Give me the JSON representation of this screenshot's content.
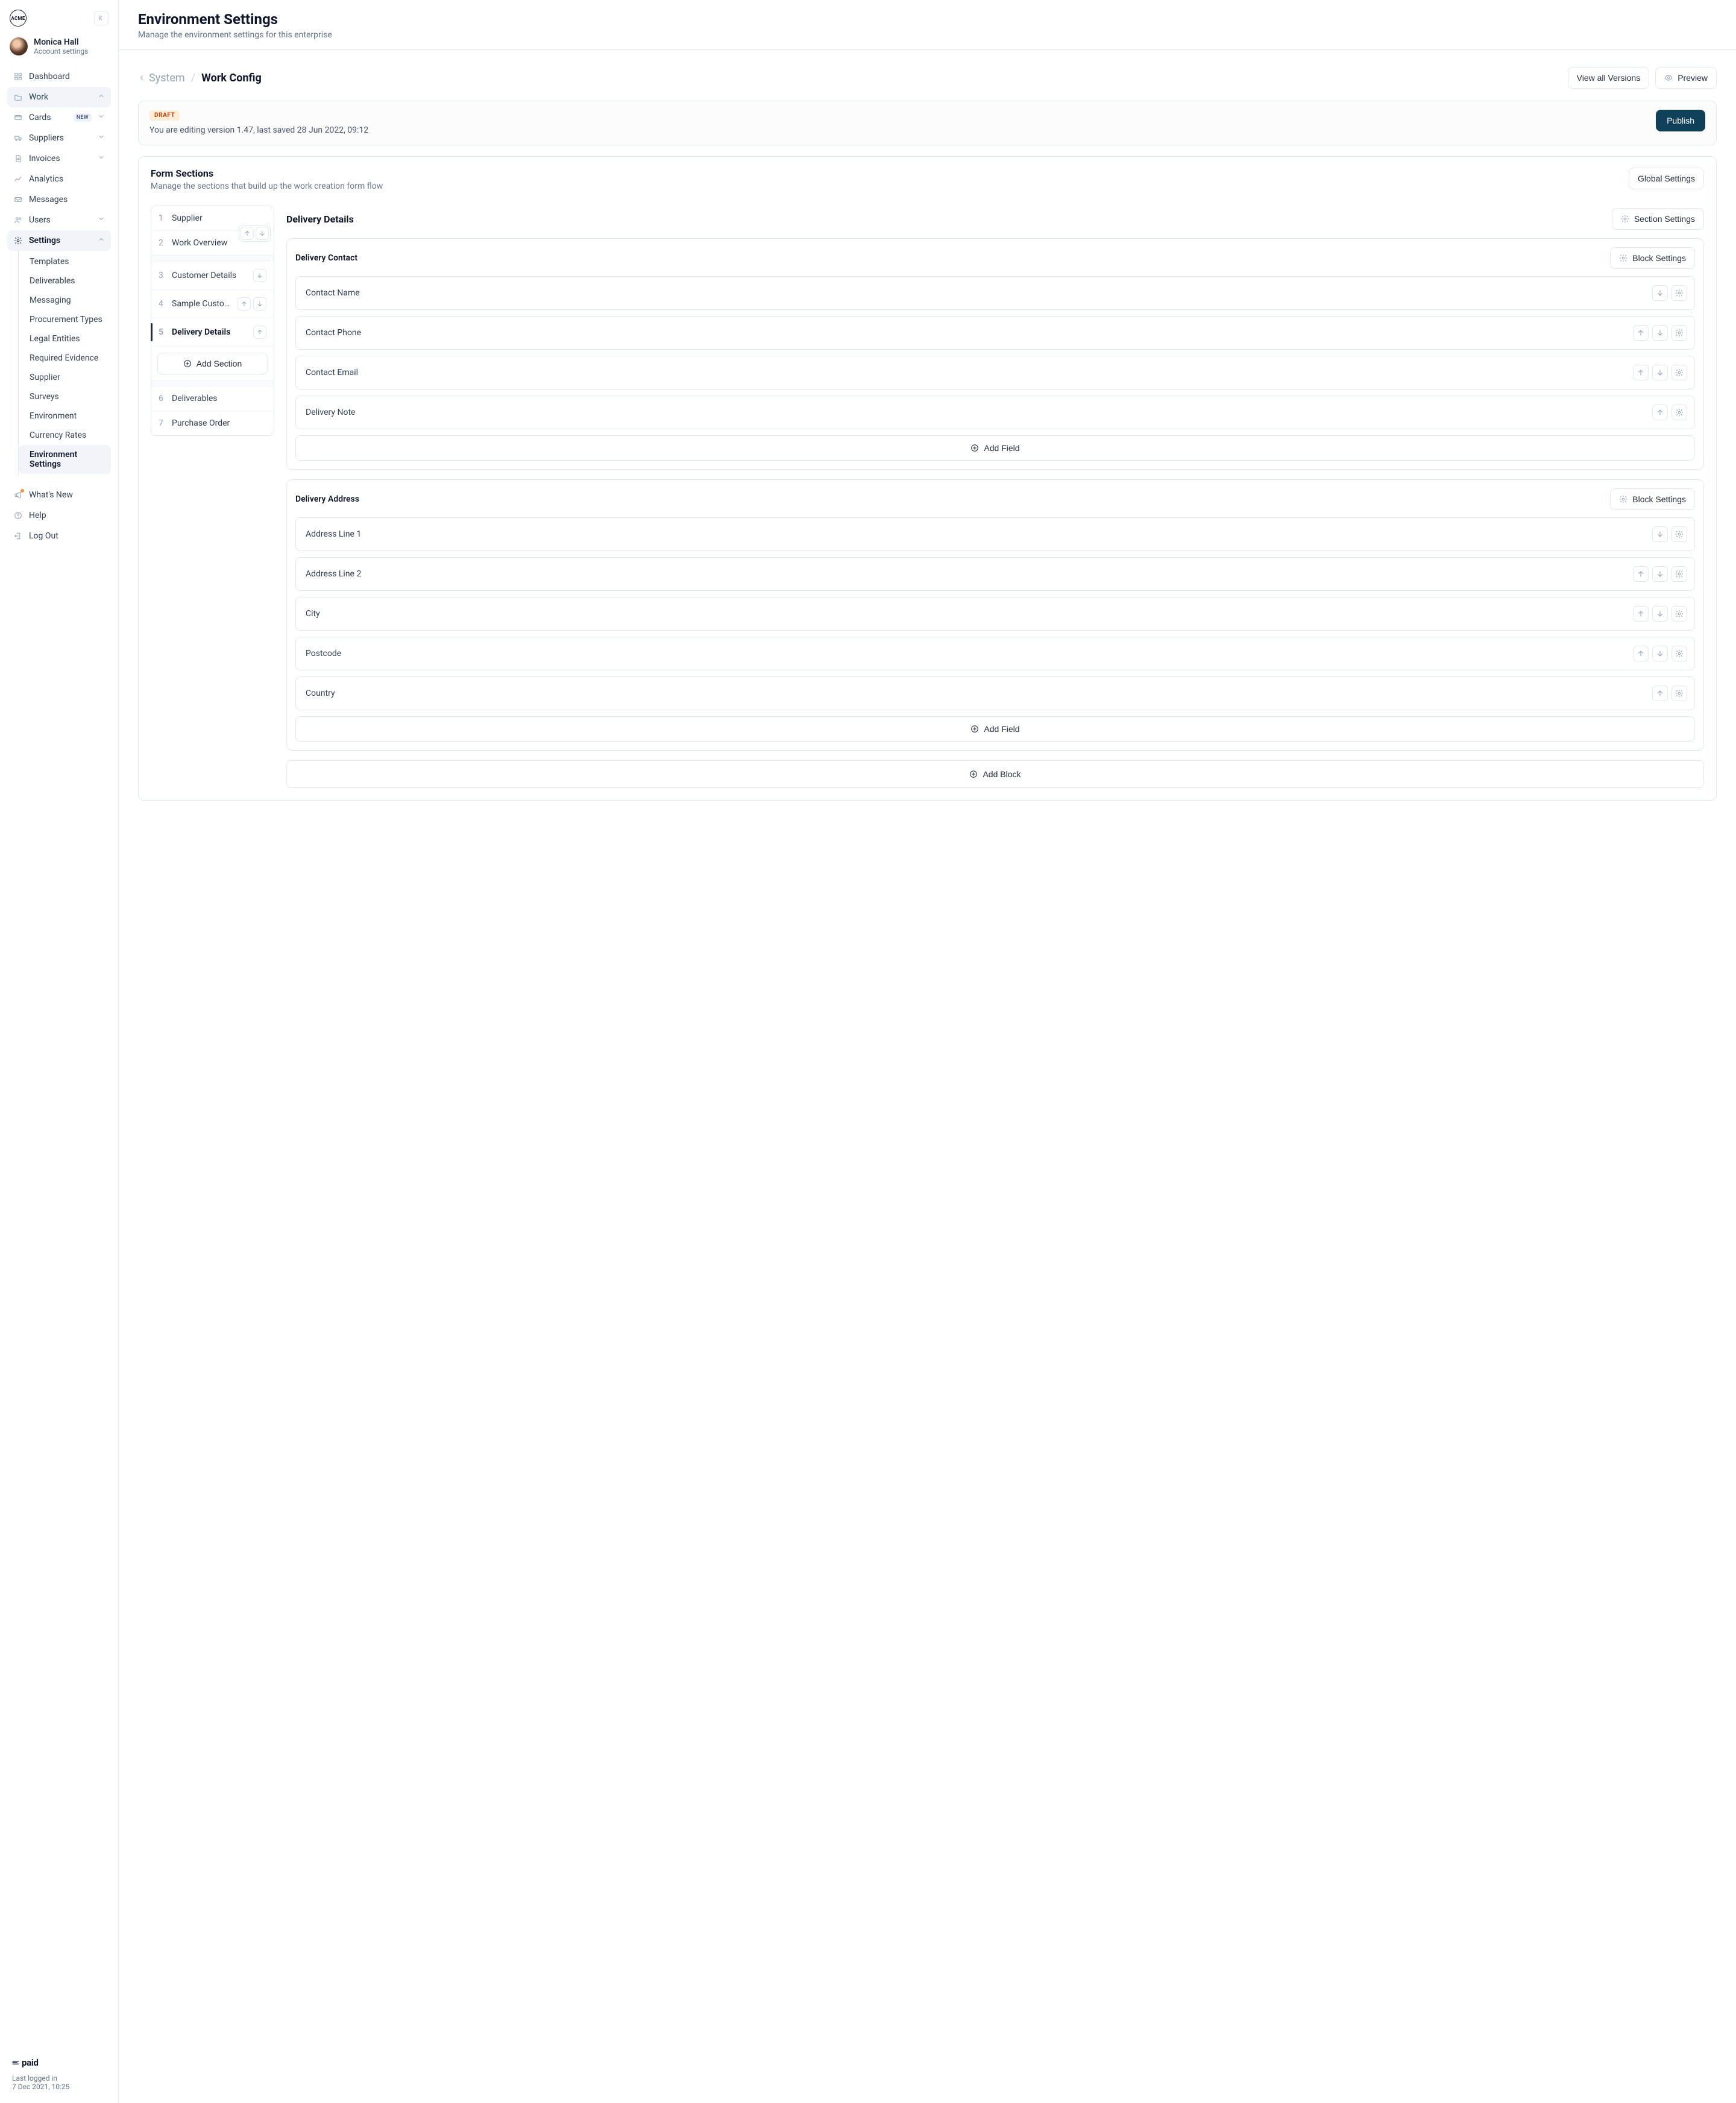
{
  "brand": "ACME",
  "user": {
    "name": "Monica Hall",
    "sub": "Account settings"
  },
  "nav": {
    "dashboard": "Dashboard",
    "work": "Work",
    "cards": "Cards",
    "cards_badge": "NEW",
    "suppliers": "Suppliers",
    "invoices": "Invoices",
    "analytics": "Analytics",
    "messages": "Messages",
    "users": "Users",
    "settings": "Settings",
    "settings_children": {
      "templates": "Templates",
      "deliverables": "Deliverables",
      "messaging": "Messaging",
      "procurement_types": "Procurement Types",
      "legal_entities": "Legal Entities",
      "required_evidence": "Required Evidence",
      "supplier": "Supplier",
      "surveys": "Surveys",
      "environment": "Environment",
      "currency_rates": "Currency Rates",
      "environment_settings": "Environment Settings"
    },
    "whats_new": "What's New",
    "help": "Help",
    "log_out": "Log Out"
  },
  "footer": {
    "brand": "paid",
    "last_logged_label": "Last logged in",
    "last_logged_value": "7 Dec 2021, 10:25"
  },
  "page": {
    "title": "Environment Settings",
    "subtitle": "Manage the environment settings for this enterprise"
  },
  "breadcrumb": {
    "back": "System",
    "current": "Work Config"
  },
  "actions": {
    "view_all_versions": "View all Versions",
    "preview": "Preview",
    "publish": "Publish",
    "global_settings": "Global Settings",
    "section_settings": "Section Settings",
    "block_settings": "Block Settings",
    "add_section": "Add Section",
    "add_field": "Add Field",
    "add_block": "Add Block"
  },
  "draft": {
    "tag": "DRAFT",
    "message": "You are editing version 1.47, last saved 28 Jun 2022, 09:12"
  },
  "form_sections_panel": {
    "title": "Form Sections",
    "subtitle": "Manage the sections that build up the work creation form flow"
  },
  "sections": [
    {
      "num": "1",
      "name": "Supplier"
    },
    {
      "num": "2",
      "name": "Work Overview"
    },
    {
      "num": "3",
      "name": "Customer Details"
    },
    {
      "num": "4",
      "name": "Sample Custom Section"
    },
    {
      "num": "5",
      "name": "Delivery Details"
    },
    {
      "num": "6",
      "name": "Deliverables"
    },
    {
      "num": "7",
      "name": "Purchase Order"
    }
  ],
  "detail": {
    "title": "Delivery Details",
    "blocks": [
      {
        "title": "Delivery Contact",
        "fields": [
          {
            "label": "Contact Name",
            "up": false,
            "down": true,
            "gear": true
          },
          {
            "label": "Contact Phone",
            "up": true,
            "down": true,
            "gear": true
          },
          {
            "label": "Contact Email",
            "up": true,
            "down": true,
            "gear": true
          },
          {
            "label": "Delivery Note",
            "up": true,
            "down": false,
            "gear": true
          }
        ]
      },
      {
        "title": "Delivery Address",
        "fields": [
          {
            "label": "Address Line 1",
            "up": false,
            "down": true,
            "gear": true
          },
          {
            "label": "Address Line 2",
            "up": true,
            "down": true,
            "gear": true
          },
          {
            "label": "City",
            "up": true,
            "down": true,
            "gear": true
          },
          {
            "label": "Postcode",
            "up": true,
            "down": true,
            "gear": true
          },
          {
            "label": "Country",
            "up": true,
            "down": false,
            "gear": true
          }
        ]
      }
    ]
  }
}
